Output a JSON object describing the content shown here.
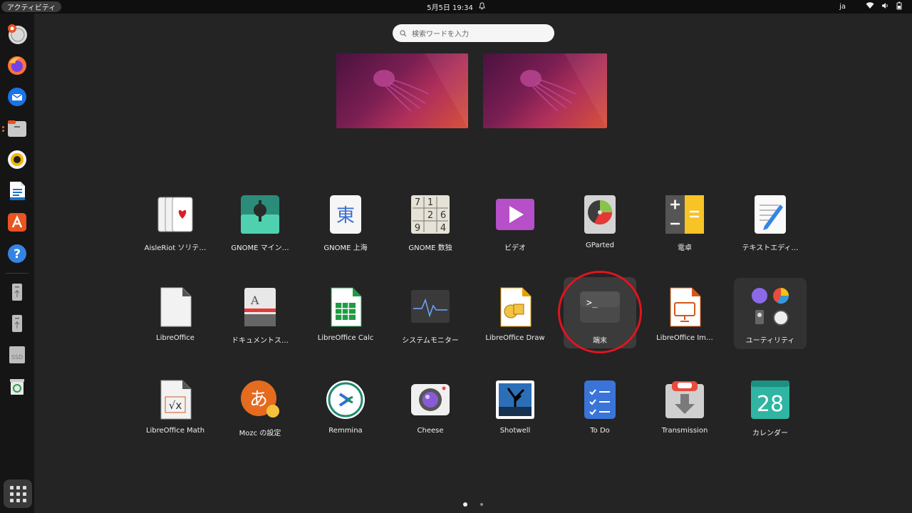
{
  "topbar": {
    "activities_label": "アクティビティ",
    "datetime": "5月5日  19:34",
    "input_method": "ja"
  },
  "dock": {
    "items": [
      {
        "name": "ubuntu-installer"
      },
      {
        "name": "firefox"
      },
      {
        "name": "thunderbird"
      },
      {
        "name": "files"
      },
      {
        "name": "rhythmbox"
      },
      {
        "name": "libreoffice-writer"
      },
      {
        "name": "ubuntu-software"
      },
      {
        "name": "help"
      },
      {
        "name": "usb-drive-1"
      },
      {
        "name": "usb-drive-2"
      },
      {
        "name": "ssd-drive",
        "label": "SSD"
      },
      {
        "name": "trash"
      }
    ]
  },
  "search": {
    "placeholder": "検索ワードを入力"
  },
  "apps": {
    "row1": [
      {
        "label": "AisleRiot ソリテ…"
      },
      {
        "label": "GNOME マイン…"
      },
      {
        "label": "GNOME 上海",
        "icon_text": "東"
      },
      {
        "label": "GNOME 数独",
        "icon_digits": [
          "7",
          "1",
          "",
          "",
          "",
          "6",
          "",
          "",
          ""
        ],
        "icon_cells": [
          "7",
          "1",
          "",
          "2",
          "",
          "6",
          "9",
          "",
          "4"
        ]
      },
      {
        "label": "ビデオ"
      },
      {
        "label": "GParted"
      },
      {
        "label": "電卓"
      },
      {
        "label": "テキストエディ…"
      }
    ],
    "row2": [
      {
        "label": "LibreOffice"
      },
      {
        "label": "ドキュメントス…",
        "icon_text": "A"
      },
      {
        "label": "LibreOffice Calc"
      },
      {
        "label": "システムモニター"
      },
      {
        "label": "LibreOffice Draw"
      },
      {
        "label": "端末",
        "icon_text": ">_"
      },
      {
        "label": "LibreOffice Im…"
      },
      {
        "label": "ユーティリティ"
      }
    ],
    "row3": [
      {
        "label": "LibreOffice Math",
        "icon_text": "√x"
      },
      {
        "label": "Mozc の設定",
        "icon_text": "あ"
      },
      {
        "label": "Remmina"
      },
      {
        "label": "Cheese"
      },
      {
        "label": "Shotwell"
      },
      {
        "label": "To Do"
      },
      {
        "label": "Transmission"
      },
      {
        "label": "カレンダー",
        "icon_text": "28"
      }
    ]
  },
  "colors": {
    "highlight_circle": "#e0141e",
    "accent": "#e95420"
  },
  "pager": {
    "current_page": 1,
    "page_count": 2
  }
}
